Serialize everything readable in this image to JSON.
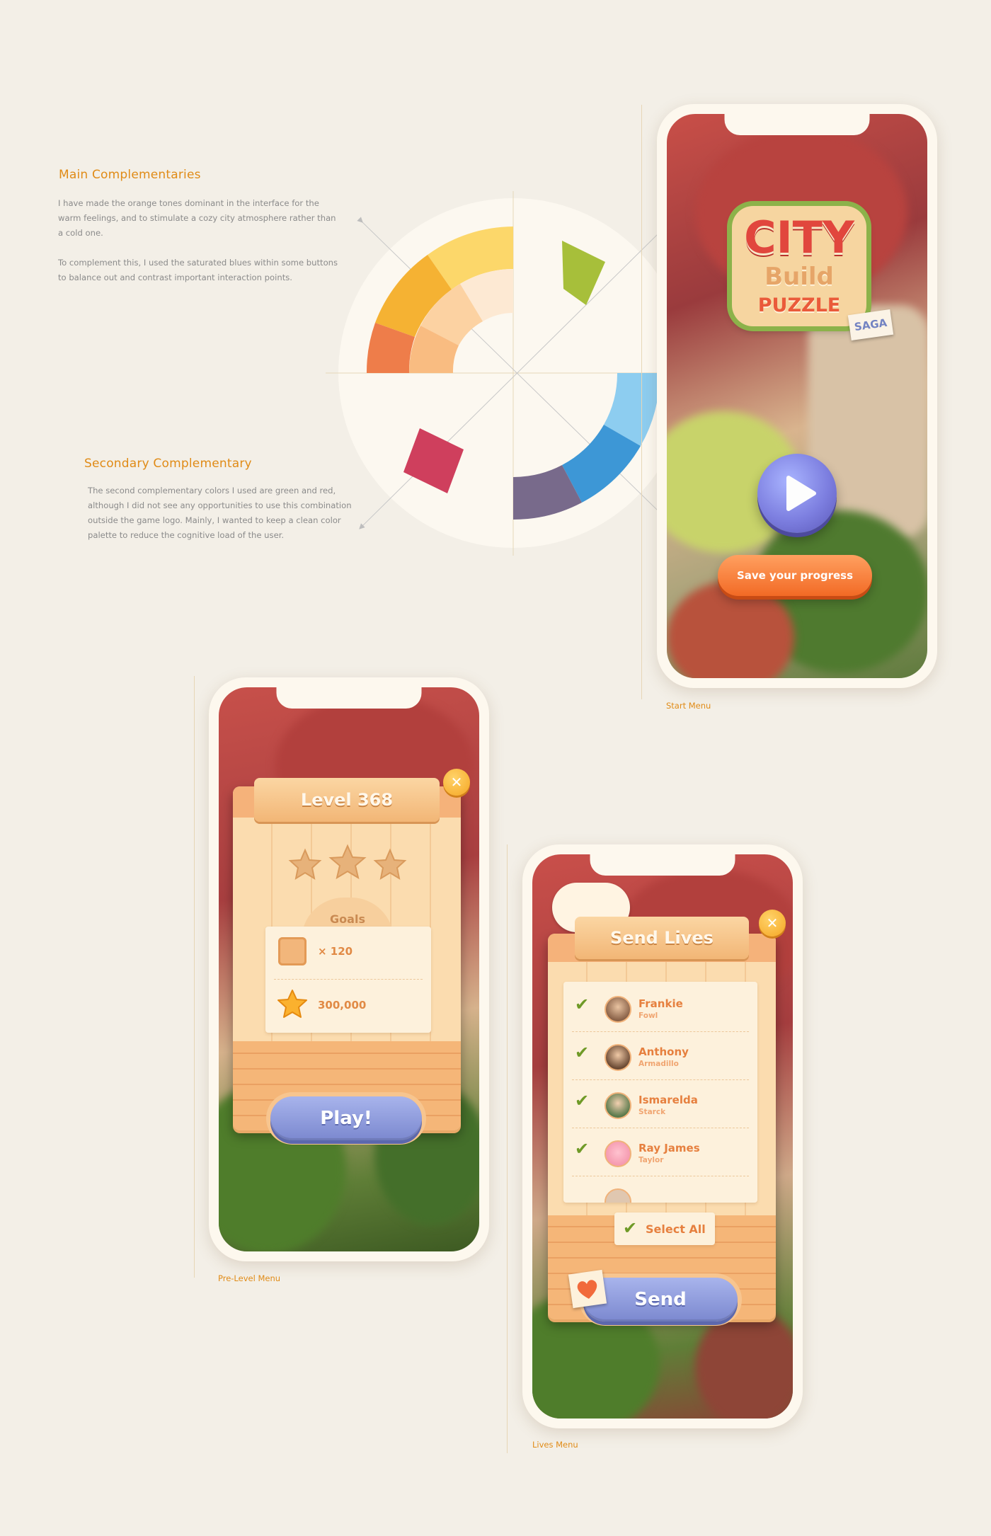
{
  "colors": {
    "accent": "#e08b17",
    "wheel_yellow": "#fcd76a",
    "wheel_orange": "#f5b233",
    "wheel_coral": "#ee7d4a",
    "wheel_peach_light": "#fde9d3",
    "wheel_peach": "#fcd2a2",
    "wheel_apricot": "#f9bc81",
    "green": "#a7bf3a",
    "red": "#cf3f5d",
    "sky_blue": "#8dcdf0",
    "blue": "#3d97d6",
    "slate_purple": "#786a8b"
  },
  "main": {
    "title": "Main Complementaries",
    "paragraphs": [
      "I have made the orange tones dominant in the interface for the warm feelings, and to stimulate a cozy city atmosphere rather than a cold one.",
      "To complement this, I used the saturated blues within some buttons to balance out and contrast important interaction points."
    ]
  },
  "secondary": {
    "title": "Secondary Complementary",
    "paragraphs": [
      "The second complementary colors I used are green and red, although I did not see any opportunities to use this combination outside the game logo. Mainly, I wanted to keep a clean color palette to reduce the cognitive load of the user."
    ]
  },
  "start_menu": {
    "caption": "Start Menu",
    "logo": {
      "word1": "CITY",
      "word2": "Build",
      "word3": "PUZZLE",
      "tag": "SAGA"
    },
    "play_icon": "play-icon",
    "save_label": "Save your progress"
  },
  "pre_level": {
    "caption": "Pre-Level Menu",
    "title": "Level 368",
    "close_icon": "close-icon",
    "goals_label": "Goals",
    "goals": [
      {
        "icon": "brick-tile-icon",
        "value": "× 120"
      },
      {
        "icon": "star-icon",
        "value": "300,000"
      }
    ],
    "play_label": "Play!"
  },
  "lives_menu": {
    "caption": "Lives Menu",
    "title": "Send Lives",
    "close_icon": "close-icon",
    "friends": [
      {
        "name": "Frankie",
        "sub": "Fowl",
        "checked": true
      },
      {
        "name": "Anthony",
        "sub": "Armadillo",
        "checked": true
      },
      {
        "name": "Ismarelda",
        "sub": "Starck",
        "checked": true
      },
      {
        "name": "Ray James",
        "sub": "Taylor",
        "checked": true
      }
    ],
    "select_all_label": "Select All",
    "send_label": "Send",
    "heart_icon": "heart-icon"
  }
}
